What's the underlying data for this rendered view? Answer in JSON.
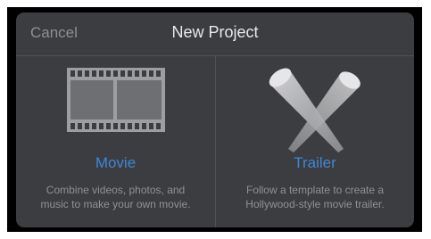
{
  "header": {
    "cancel_label": "Cancel",
    "title": "New Project"
  },
  "options": [
    {
      "label": "Movie",
      "description_lines": [
        "Combine videos, photos, and",
        "music to make your own movie."
      ],
      "icon": "film-strip-icon"
    },
    {
      "label": "Trailer",
      "description_lines": [
        "Follow a template to create a",
        "Hollywood-style movie trailer."
      ],
      "icon": "spotlights-icon"
    }
  ],
  "colors": {
    "dialog_background": "#3c3d40",
    "accent": "#3f86d8",
    "secondary_text": "#909194",
    "title_text": "#e9e9ea"
  }
}
